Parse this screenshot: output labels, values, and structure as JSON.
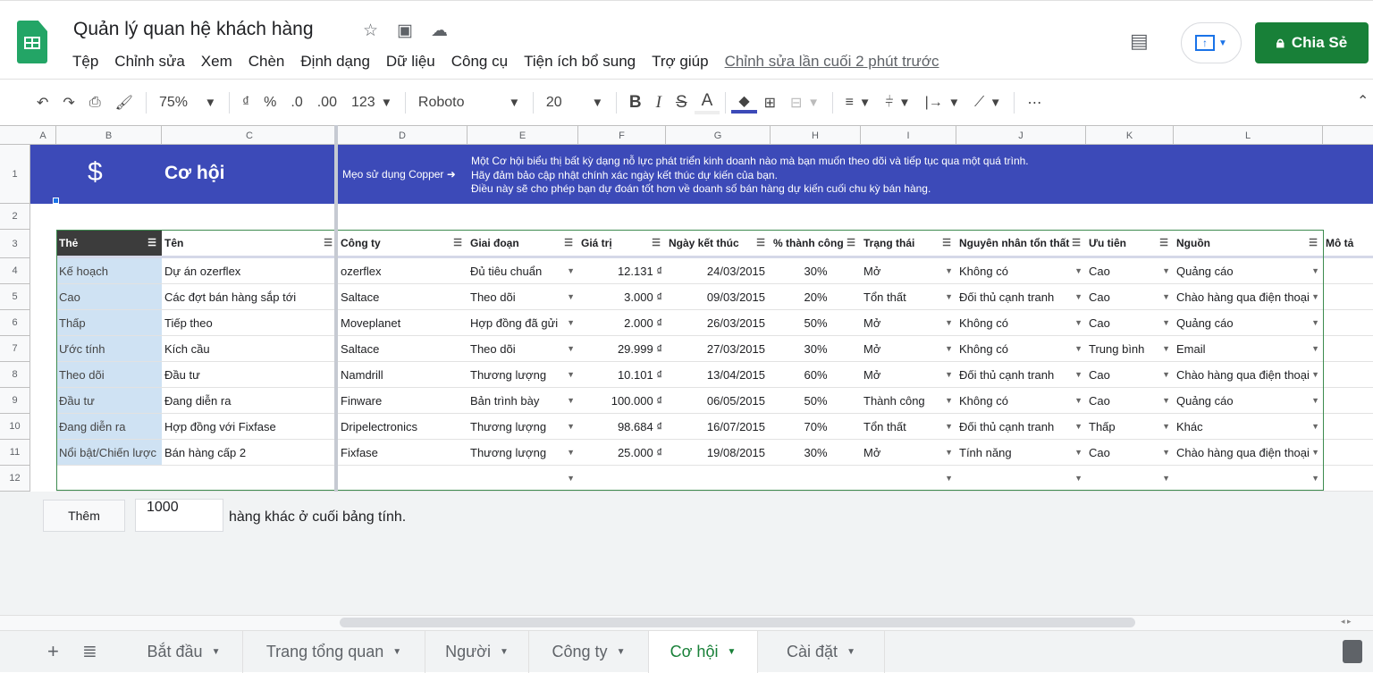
{
  "app": {
    "title": "Quản lý quan hệ khách hàng",
    "menu": [
      "Tệp",
      "Chỉnh sửa",
      "Xem",
      "Chèn",
      "Định dạng",
      "Dữ liệu",
      "Công cụ",
      "Tiện ích bổ sung",
      "Trợ giúp"
    ],
    "last_edit": "Chỉnh sửa lần cuối 2 phút trước",
    "share_label": "Chia Sẻ",
    "accent": "#188038"
  },
  "toolbar": {
    "zoom": "75%",
    "currency": "₫",
    "percent": "%",
    "dec_less": ".0",
    "dec_more": ".00",
    "format": "123",
    "font": "Roboto",
    "font_size": "20",
    "bold": "B",
    "italic": "I",
    "strike": "S",
    "text_color": "A",
    "more": "⋯"
  },
  "columns": [
    "A",
    "B",
    "C",
    "D",
    "E",
    "F",
    "G",
    "H",
    "I",
    "J",
    "K",
    "L"
  ],
  "banner": {
    "icon": "$",
    "title": "Cơ hội",
    "tip": "Mẹo sử dụng Copper ➜",
    "lines": [
      "Một Cơ hội biểu thị bất kỳ dạng nỗ lực phát triển kinh doanh nào mà bạn muốn theo dõi và tiếp tục qua một quá trình.",
      "Hãy đảm bảo cập nhật chính xác ngày kết thúc dự kiến của bạn.",
      "Điều này sẽ cho phép bạn dự đoán tốt hơn về doanh số bán hàng dự kiến cuối chu kỳ bán hàng."
    ],
    "color": "#3c4ab8"
  },
  "table": {
    "headers": [
      "Thẻ",
      "Tên",
      "Công ty",
      "Giai đoạn",
      "Giá trị",
      "Ngày kết thúc",
      "% thành công",
      "Trạng thái",
      "Nguyên nhân tổn thất",
      "Ưu tiên",
      "Nguồn",
      "Mô tả"
    ],
    "rows": [
      [
        "Kế hoạch",
        "Dự án ozerflex",
        "ozerflex",
        "Đủ tiêu chuẩn",
        "12.131 ₫",
        "24/03/2015",
        "30%",
        "Mở",
        "Không có",
        "Cao",
        "Quảng cáo"
      ],
      [
        "Cao",
        "Các đợt bán hàng sắp tới",
        "Saltace",
        "Theo dõi",
        "3.000 ₫",
        "09/03/2015",
        "20%",
        "Tổn thất",
        "Đối thủ cạnh tranh",
        "Cao",
        "Chào hàng qua điện thoại"
      ],
      [
        "Thấp",
        "Tiếp theo",
        "Moveplanet",
        "Hợp đồng đã gửi",
        "2.000 ₫",
        "26/03/2015",
        "50%",
        "Mở",
        "Không có",
        "Cao",
        "Quảng cáo"
      ],
      [
        "Ước tính",
        "Kích cầu",
        "Saltace",
        "Theo dõi",
        "29.999 ₫",
        "27/03/2015",
        "30%",
        "Mở",
        "Không có",
        "Trung bình",
        "Email"
      ],
      [
        "Theo dõi",
        "Đầu tư",
        "Namdrill",
        "Thương lượng",
        "10.101 ₫",
        "13/04/2015",
        "60%",
        "Mở",
        "Đối thủ cạnh tranh",
        "Cao",
        "Chào hàng qua điện thoại"
      ],
      [
        "Đầu tư",
        "Đang diễn ra",
        "Finware",
        "Bản trình bày",
        "100.000 ₫",
        "06/05/2015",
        "50%",
        "Thành công",
        "Không có",
        "Cao",
        "Quảng cáo"
      ],
      [
        "Đang diễn ra",
        "Hợp đồng với Fixfase",
        "Dripelectronics",
        "Thương lượng",
        "98.684 ₫",
        "16/07/2015",
        "70%",
        "Tổn thất",
        "Đối thủ cạnh tranh",
        "Thấp",
        "Khác"
      ],
      [
        "Nổi bật/Chiến lược",
        "Bán hàng cấp 2",
        "Fixfase",
        "Thương lượng",
        "25.000 ₫",
        "19/08/2015",
        "30%",
        "Mở",
        "Tính năng",
        "Cao",
        "Chào hàng qua điện thoại"
      ],
      [
        "",
        "",
        "",
        "",
        "",
        "",
        "",
        "",
        "",
        "",
        ""
      ]
    ]
  },
  "add_rows": {
    "button": "Thêm",
    "count": "1000",
    "suffix": "hàng khác ở cuối bảng tính."
  },
  "sheets": [
    {
      "label": "Bắt đầu"
    },
    {
      "label": "Trang tổng quan"
    },
    {
      "label": "Người"
    },
    {
      "label": "Công ty"
    },
    {
      "label": "Cơ hội",
      "active": true
    },
    {
      "label": "Cài đặt"
    }
  ]
}
